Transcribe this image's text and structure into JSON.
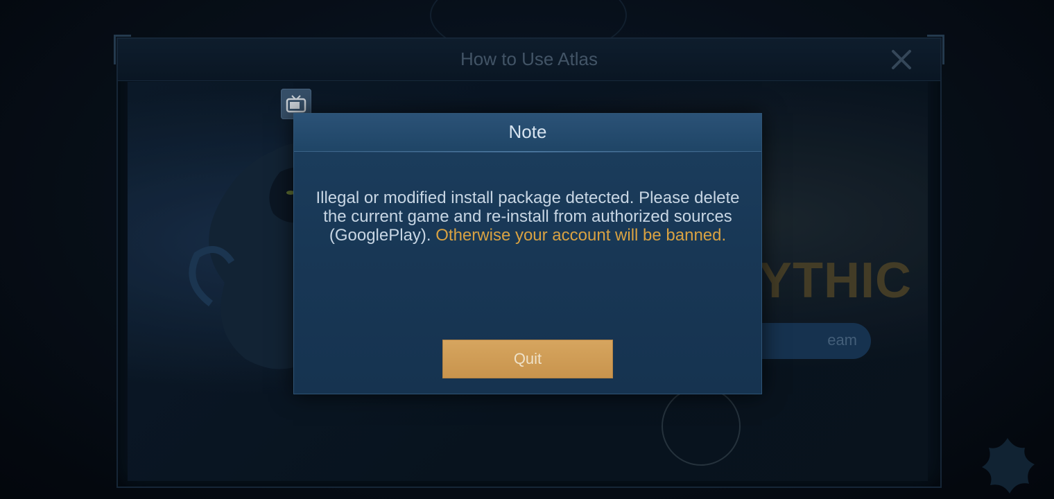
{
  "background_panel": {
    "title": "How to Use Atlas",
    "close_icon": "close-icon",
    "mythic_text": "YTHIC",
    "pill_text": "eam"
  },
  "note_dialog": {
    "title": "Note",
    "message_normal": "Illegal or modified install package detected. Please delete the current game and re-install from authorized sources (GooglePlay). ",
    "message_warning": "Otherwise your account will be banned.",
    "quit_label": "Quit"
  },
  "icons": {
    "tv": "tv-icon",
    "close": "close-icon"
  },
  "colors": {
    "warning": "#d9a242",
    "button": "#d6a55f",
    "dialog": "#1c3e5e"
  }
}
